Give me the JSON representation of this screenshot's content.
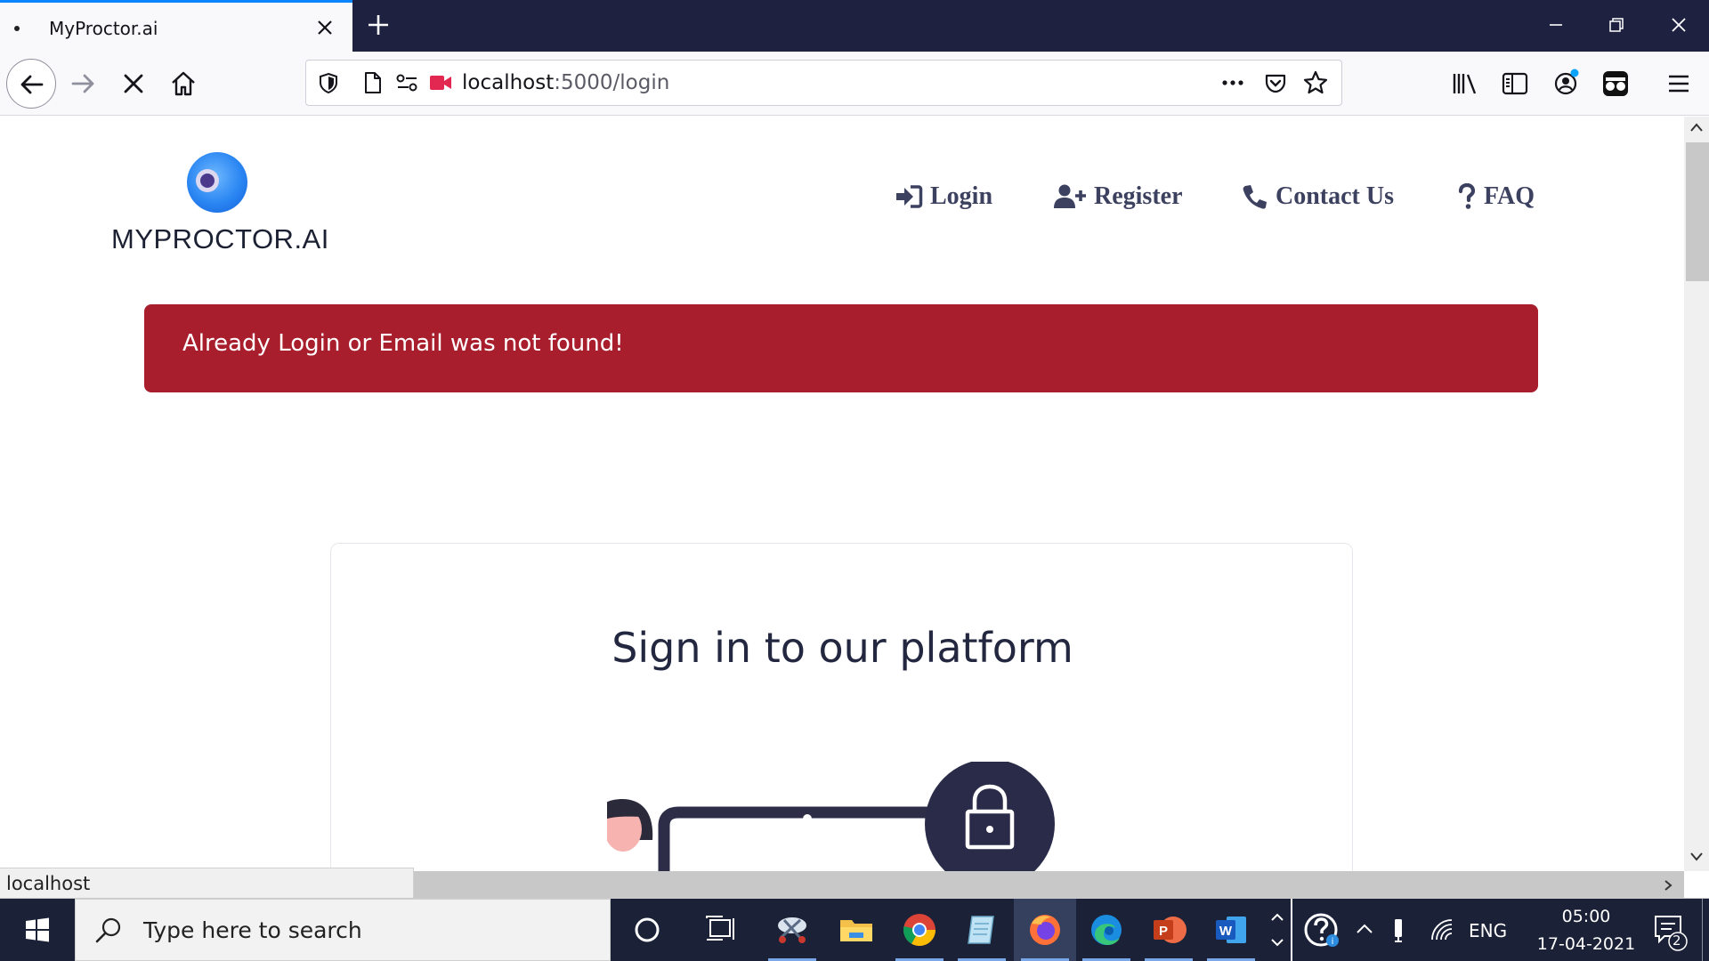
{
  "browser": {
    "tab_title": "MyProctor.ai",
    "url_host": "localhost",
    "url_rest": ":5000/login",
    "status_text": "localhost"
  },
  "site": {
    "brand": "MYPROCTOR.AI",
    "menu": [
      {
        "label": "Login",
        "icon": "sign-in-icon"
      },
      {
        "label": "Register",
        "icon": "user-plus-icon"
      },
      {
        "label": "Contact Us",
        "icon": "phone-icon"
      },
      {
        "label": "FAQ",
        "icon": "question-icon"
      }
    ],
    "alert_text": "Already Login or Email was not found!",
    "card_title": "Sign in to our platform"
  },
  "taskbar": {
    "search_placeholder": "Type here to search",
    "language": "ENG",
    "time": "05:00",
    "date": "17-04-2021",
    "notification_count": "2"
  },
  "colors": {
    "alert_bg": "#a81e2d",
    "menu_text": "#3d4160",
    "tab_accent": "#0a84ff",
    "titlebar_bg": "#1e2140"
  }
}
